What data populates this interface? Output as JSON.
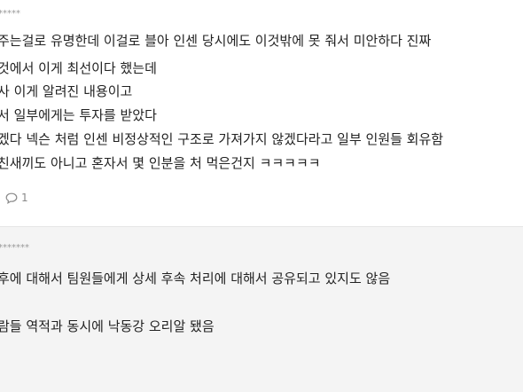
{
  "comments": [
    {
      "author": "*****",
      "lines": [
        "주는걸로 유명한데 이걸로 블아 인센 당시에도 이것밖에 못 줘서 미안하다 진짜",
        "것에서 이게 최선이다 했는데",
        "사 이게 알려진 내용이고",
        "서 일부에게는 투자를 받았다",
        "겠다 넥슨 처럼 인센 비정상적인 구조로 가져가지 않겠다라고 일부 인원들 회유함",
        "친새끼도 아니고 혼자서 몇 인분을 처 먹은건지 ㅋㅋㅋㅋㅋ"
      ],
      "reply_icon": "reply-bubble-icon",
      "reply_count": "1"
    },
    {
      "author": "*******",
      "lines": [
        "후에 대해서 팀원들에게 상세 후속 처리에 대해서 공유되고 있지도 않음",
        "",
        "람들 역적과 동시에 낙동강 오리알 됐음"
      ]
    }
  ]
}
